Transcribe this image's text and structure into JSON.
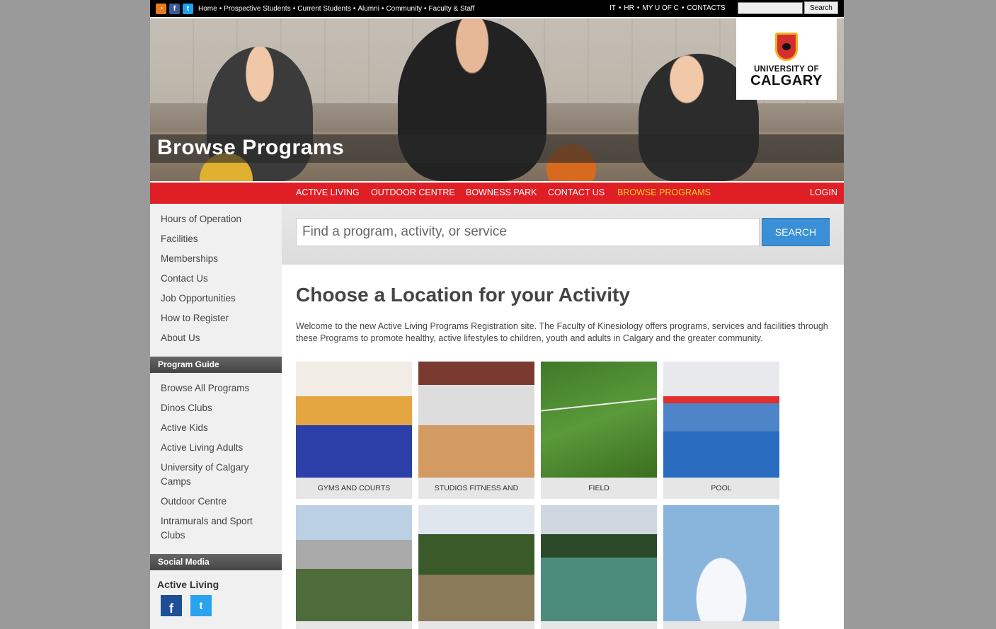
{
  "topbar": {
    "social": [
      "rss-icon",
      "facebook-icon",
      "twitter-icon"
    ],
    "links": [
      "Home",
      "Prospective Students",
      "Current Students",
      "Alumni",
      "Community",
      "Faculty & Staff"
    ],
    "right_links": [
      "IT",
      "HR",
      "MY U OF C",
      "CONTACTS"
    ],
    "search_button": "Search"
  },
  "hero": {
    "title": "Browse Programs",
    "logo_line1": "UNIVERSITY OF",
    "logo_line2": "CALGARY"
  },
  "nav": {
    "items": [
      "ACTIVE LIVING",
      "OUTDOOR CENTRE",
      "BOWNESS PARK",
      "CONTACT US",
      "BROWSE PROGRAMS"
    ],
    "active": "BROWSE PROGRAMS",
    "login": "LOGIN",
    "accent_color": "#e01e25",
    "active_color": "#f7d21e"
  },
  "sidebar": {
    "links": [
      "Hours of Operation",
      "Facilities",
      "Memberships",
      "Contact Us",
      "Job Opportunities",
      "How to Register",
      "About Us"
    ],
    "program_guide": {
      "heading": "Program Guide",
      "links": [
        "Browse All Programs",
        "Dinos Clubs",
        "Active Kids",
        "Active Living Adults",
        "University of Calgary Camps",
        "Outdoor Centre",
        "Intramurals and Sport Clubs"
      ]
    },
    "social": {
      "heading": "Social Media",
      "title": "Active Living",
      "icons": [
        "facebook-icon",
        "twitter-icon"
      ]
    }
  },
  "search": {
    "placeholder": "Find a program, activity, or service",
    "button": "SEARCH"
  },
  "main": {
    "title": "Choose a Location for your Activity",
    "intro": "Welcome to the new Active Living Programs Registration site. The Faculty of Kinesiology offers programs, services and facilities through these Programs to promote healthy, active lifestyles to children, youth and adults in Calgary and the greater community.",
    "tiles": [
      {
        "caption": "GYMS AND COURTS"
      },
      {
        "caption": "STUDIOS FITNESS AND"
      },
      {
        "caption": "FIELD"
      },
      {
        "caption": "POOL"
      },
      {
        "caption": ""
      },
      {
        "caption": ""
      },
      {
        "caption": ""
      },
      {
        "caption": ""
      }
    ]
  }
}
